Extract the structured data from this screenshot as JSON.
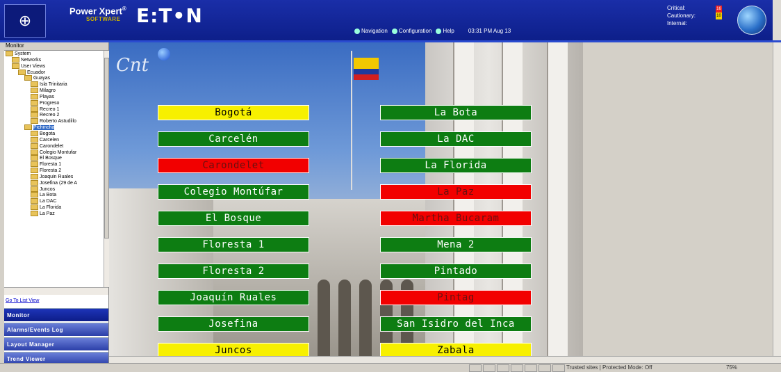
{
  "header": {
    "product": "Power Xpert",
    "product_mark": "®",
    "subtitle": "SOFTWARE",
    "brand": "E:T•N",
    "nav": [
      "Navigation",
      "Configuration",
      "Help"
    ],
    "time": "03:31 PM Aug 13",
    "status_labels": [
      "Critical:",
      "Cautionary:",
      "Internal:"
    ],
    "status_badges": [
      "16",
      "10"
    ]
  },
  "left": {
    "title": "Monitor",
    "tree": [
      {
        "label": "System",
        "indent": 0
      },
      {
        "label": "Networks",
        "indent": 1
      },
      {
        "label": "User Views",
        "indent": 1
      },
      {
        "label": "Ecuador",
        "indent": 2
      },
      {
        "label": "Guayas",
        "indent": 3
      },
      {
        "label": "Isla Trinitaria",
        "indent": 4
      },
      {
        "label": "Milagro",
        "indent": 4
      },
      {
        "label": "Playas",
        "indent": 4
      },
      {
        "label": "Progreso",
        "indent": 4
      },
      {
        "label": "Recreo 1",
        "indent": 4
      },
      {
        "label": "Recreo 2",
        "indent": 4
      },
      {
        "label": "Roberto Astudillo",
        "indent": 4
      },
      {
        "label": "Pichincha",
        "indent": 3,
        "selected": true
      },
      {
        "label": "Bogota",
        "indent": 4
      },
      {
        "label": "Carcelen",
        "indent": 4
      },
      {
        "label": "Carondelet",
        "indent": 4
      },
      {
        "label": "Colegio Montufar",
        "indent": 4
      },
      {
        "label": "El Bosque",
        "indent": 4
      },
      {
        "label": "Floresta 1",
        "indent": 4
      },
      {
        "label": "Floresta 2",
        "indent": 4
      },
      {
        "label": "Joaquin Ruales",
        "indent": 4
      },
      {
        "label": "Josefina (29 de A",
        "indent": 4
      },
      {
        "label": "Juncos",
        "indent": 4
      },
      {
        "label": "La Bota",
        "indent": 4
      },
      {
        "label": "La DAC",
        "indent": 4
      },
      {
        "label": "La Florida",
        "indent": 4
      },
      {
        "label": "La Paz",
        "indent": 4
      }
    ],
    "goto": "Go To List View",
    "buttons": [
      "Monitor",
      "Alarms/Events Log",
      "Layout Manager",
      "Trend Viewer"
    ]
  },
  "sites_left": [
    {
      "label": "Bogotá",
      "status": "yellow"
    },
    {
      "label": "Carcelén",
      "status": "green"
    },
    {
      "label": "Carondelet",
      "status": "red"
    },
    {
      "label": "Colegio Montúfar",
      "status": "green"
    },
    {
      "label": "El Bosque",
      "status": "green"
    },
    {
      "label": "Floresta 1",
      "status": "green"
    },
    {
      "label": "Floresta 2",
      "status": "green"
    },
    {
      "label": "Joaquín Ruales",
      "status": "green"
    },
    {
      "label": "Josefina",
      "status": "green"
    },
    {
      "label": "Juncos",
      "status": "yellow"
    }
  ],
  "sites_right": [
    {
      "label": "La Bota",
      "status": "green"
    },
    {
      "label": "La DAC",
      "status": "green"
    },
    {
      "label": "La Florida",
      "status": "green"
    },
    {
      "label": "La Paz",
      "status": "red"
    },
    {
      "label": "Martha Bucaram",
      "status": "red"
    },
    {
      "label": "Mena 2",
      "status": "green"
    },
    {
      "label": "Pintado",
      "status": "green"
    },
    {
      "label": "Pintag",
      "status": "red"
    },
    {
      "label": "San Isidro del Inca",
      "status": "green"
    },
    {
      "label": "Zabala",
      "status": "yellow"
    }
  ],
  "statusbar": {
    "zone": "Trusted sites | Protected Mode: Off",
    "zoom": "75%"
  },
  "colors": {
    "green": "#0d7d12",
    "yellow": "#f7f000",
    "red": "#f20000",
    "header": "#1a2ea8"
  }
}
